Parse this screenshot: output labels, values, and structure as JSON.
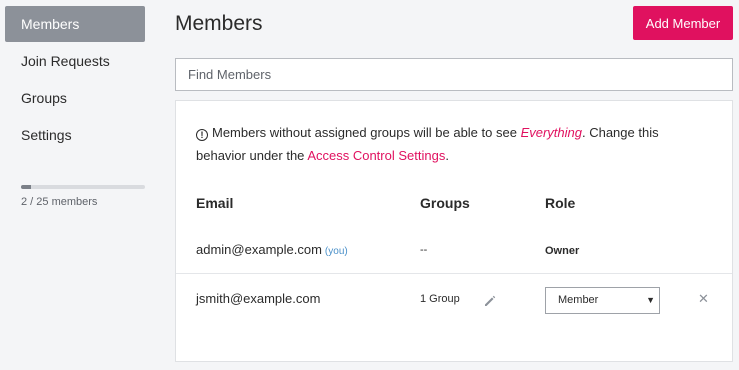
{
  "sidebar": {
    "items": [
      {
        "label": "Members",
        "active": true
      },
      {
        "label": "Join Requests"
      },
      {
        "label": "Groups"
      },
      {
        "label": "Settings"
      }
    ],
    "usage": {
      "text": "2 / 25 members",
      "used": 2,
      "limit": 25
    }
  },
  "header": {
    "title": "Members",
    "add_button": "Add Member",
    "search_placeholder": "Find Members"
  },
  "notice": {
    "icon": "info-icon",
    "text_before": "Members without assigned groups will be able to see ",
    "emphasis": "Everything",
    "text_middle": ". Change this behavior under the ",
    "link": "Access Control Settings",
    "text_after": "."
  },
  "table": {
    "columns": {
      "email": "Email",
      "groups": "Groups",
      "role": "Role"
    },
    "rows": [
      {
        "email": "admin@example.com",
        "you": "(you)",
        "groups": "--",
        "role": "Owner"
      },
      {
        "email": "jsmith@example.com",
        "groups": "1 Group",
        "role": "Member"
      }
    ]
  },
  "colors": {
    "accent": "#e0115f",
    "active_nav": "#8c9199",
    "link_blue": "#4a90c9"
  }
}
